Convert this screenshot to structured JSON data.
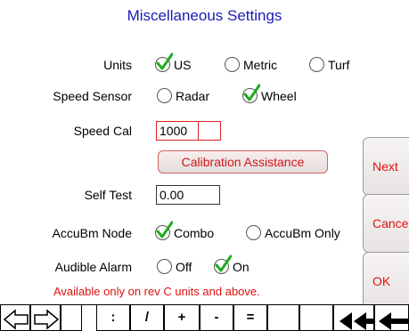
{
  "title": "Miscellaneous Settings",
  "units": {
    "label": "Units",
    "options": [
      "US",
      "Metric",
      "Turf"
    ],
    "selected": "US"
  },
  "speed_sensor": {
    "label": "Speed Sensor",
    "options": [
      "Radar",
      "Wheel"
    ],
    "selected": "Wheel"
  },
  "speed_cal": {
    "label": "Speed Cal",
    "value": "1000"
  },
  "calibration_button": "Calibration Assistance",
  "self_test": {
    "label": "Self Test",
    "value": "0.00"
  },
  "accubm_node": {
    "label": "AccuBm Node",
    "options": [
      "Combo",
      "AccuBm Only"
    ],
    "selected": "Combo"
  },
  "audible_alarm": {
    "label": "Audible Alarm",
    "options": [
      "Off",
      "On"
    ],
    "selected": "On"
  },
  "note": "Available only on rev C units and above.",
  "side_buttons": {
    "next": "Next",
    "cancel": "Cance",
    "ok": "OK"
  },
  "keypad": {
    "k1": ":",
    "k2": "/",
    "k3": "+",
    "k4": "-",
    "k5": "="
  },
  "accent_color": "#e01010",
  "title_color": "#1a1ab8",
  "check_color": "#22aa22"
}
